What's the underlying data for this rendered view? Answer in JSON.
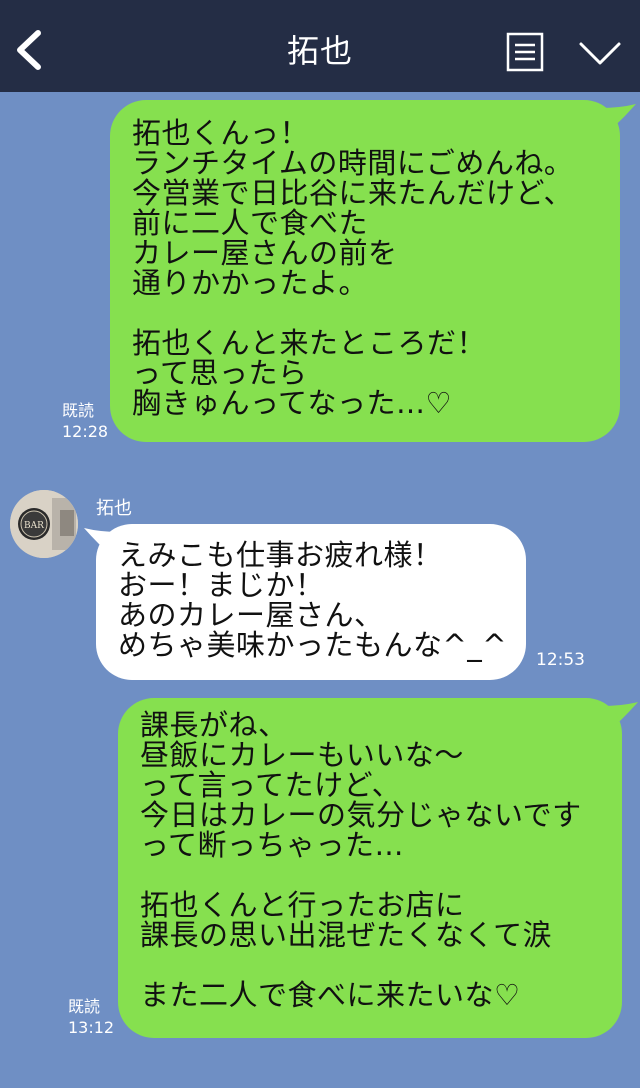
{
  "header": {
    "title": "拓也",
    "back_icon": "chevron-left-icon",
    "menu_icon": "menu-icon",
    "dropdown_icon": "chevron-down-icon",
    "background": "#242d45"
  },
  "chat_background": "#6f8fc4",
  "messages": [
    {
      "direction": "outgoing",
      "text": "拓也くんっ！\nランチタイムの時間にごめんね。\n今営業で日比谷に来たんだけど、\n前に二人で食べた\nカレー屋さんの前を\n通りかかったよ。\n\n拓也くんと来たところだ！\nって思ったら\n胸きゅんってなった…♡",
      "read_label": "既読",
      "time": "12:28"
    },
    {
      "direction": "incoming",
      "sender": "拓也",
      "avatar_label": "BAR",
      "text": "えみこも仕事お疲れ様！\nおー！まじか！\nあのカレー屋さん、\nめちゃ美味かったもんな^_^",
      "time": "12:53"
    },
    {
      "direction": "outgoing",
      "text": "課長がね、\n昼飯にカレーもいいな〜\nって言ってたけど、\n今日はカレーの気分じゃないです\nって断っちゃった…\n\n拓也くんと行ったお店に\n課長の思い出混ぜたくなくて涙\n\nまた二人で食べに来たいな♡",
      "read_label": "既読",
      "time": "13:12"
    }
  ],
  "colors": {
    "outgoing_bubble": "#86e04f",
    "incoming_bubble": "#ffffff"
  }
}
